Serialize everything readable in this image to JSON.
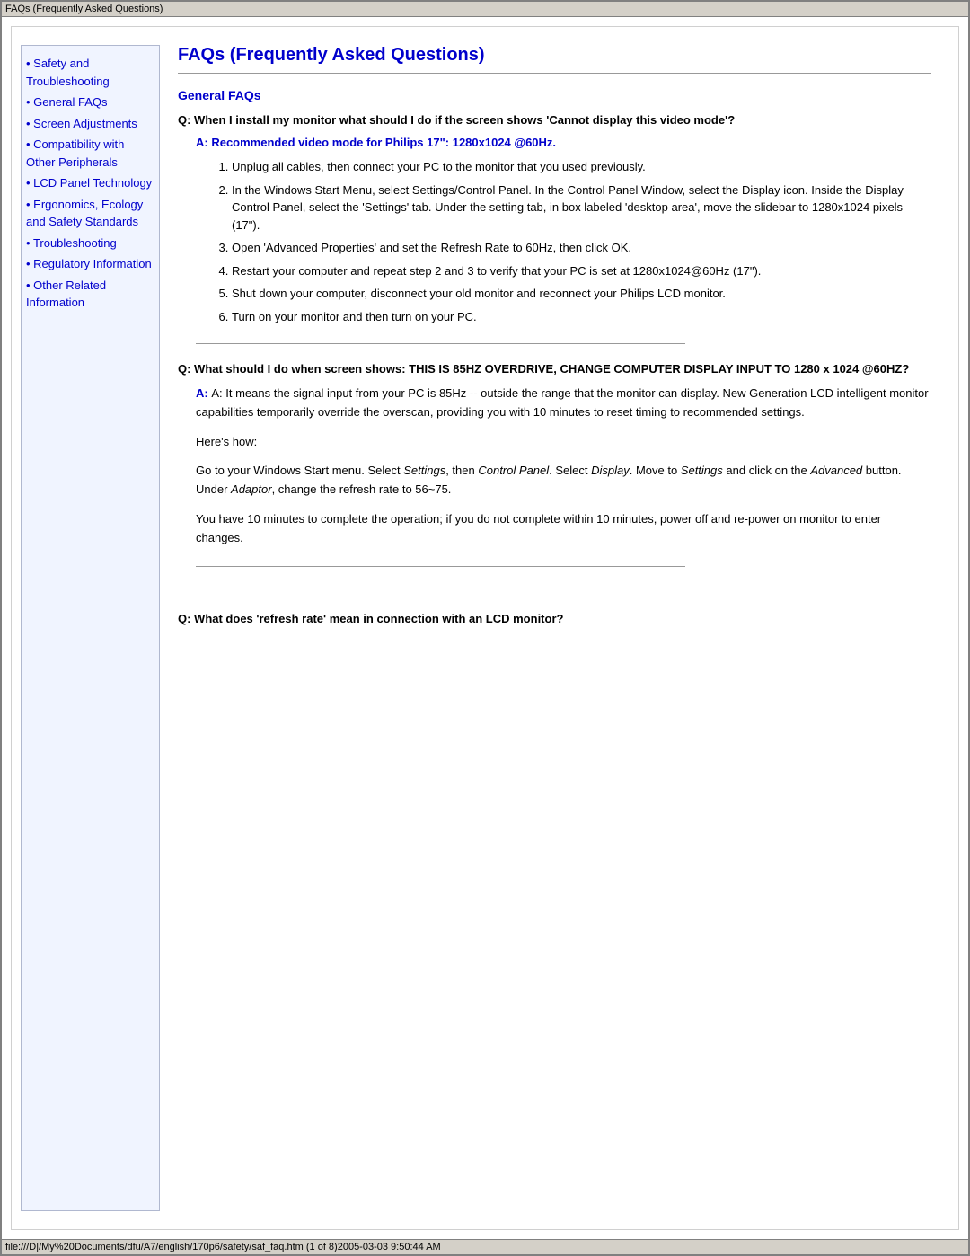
{
  "titleBar": {
    "text": "FAQs (Frequently Asked Questions)"
  },
  "sidebar": {
    "items": [
      {
        "id": "safety",
        "label": "Safety and Troubleshooting"
      },
      {
        "id": "general",
        "label": "General FAQs"
      },
      {
        "id": "screen",
        "label": "Screen Adjustments"
      },
      {
        "id": "compatibility",
        "label": "Compatibility with Other Peripherals"
      },
      {
        "id": "lcd",
        "label": "LCD Panel Technology"
      },
      {
        "id": "ergonomics",
        "label": "Ergonomics, Ecology and Safety Standards"
      },
      {
        "id": "troubleshooting",
        "label": "Troubleshooting"
      },
      {
        "id": "regulatory",
        "label": "Regulatory Information"
      },
      {
        "id": "other",
        "label": "Other Related Information"
      }
    ]
  },
  "main": {
    "pageTitle": "FAQs (Frequently Asked Questions)",
    "sectionTitle": "General FAQs",
    "q1": {
      "question": "Q: When I install my monitor what should I do if the screen shows 'Cannot display this video mode'?",
      "answerHeader": "A: Recommended video mode for Philips 17\": 1280x1024 @60Hz.",
      "steps": [
        "Unplug all cables, then connect your PC to the monitor that you used previously.",
        "In the Windows Start Menu, select Settings/Control Panel. In the Control Panel Window, select the Display icon. Inside the Display Control Panel, select the 'Settings' tab. Under the setting tab, in box labeled 'desktop area', move the slidebar to 1280x1024 pixels (17\").",
        "Open 'Advanced Properties' and set the Refresh Rate to 60Hz, then click OK.",
        "Restart your computer and repeat step 2 and 3 to verify that your PC is set at 1280x1024@60Hz (17\").",
        "Shut down your computer, disconnect your old monitor and reconnect your Philips LCD monitor.",
        "Turn on your monitor and then turn on your PC."
      ]
    },
    "q2": {
      "question": "Q: What should I do when screen shows: THIS IS 85HZ OVERDRIVE, CHANGE COMPUTER DISPLAY INPUT TO 1280 x 1024 @60HZ?",
      "answerIntro": "A: It means the signal input from your PC is 85Hz -- outside the range that the monitor can display. New Generation LCD intelligent monitor capabilities temporarily override the overscan, providing you with 10 minutes to reset timing to recommended settings.",
      "heresHow": "Here's how:",
      "goTo": "Go to your Windows Start menu. Select Settings, then Control Panel. Select Display. Move to Settings and click on the Advanced button. Under Adaptor, change the refresh rate to 56~75.",
      "tenMinutes": "You have 10 minutes to complete the operation; if you do not complete within 10 minutes, power off and re-power on monitor to enter changes."
    },
    "q3": {
      "question": "Q: What does 'refresh rate' mean in connection with an LCD monitor?"
    }
  },
  "statusBar": {
    "text": "file:///D|/My%20Documents/dfu/A7/english/170p6/safety/saf_faq.htm (1 of 8)2005-03-03 9:50:44 AM"
  }
}
